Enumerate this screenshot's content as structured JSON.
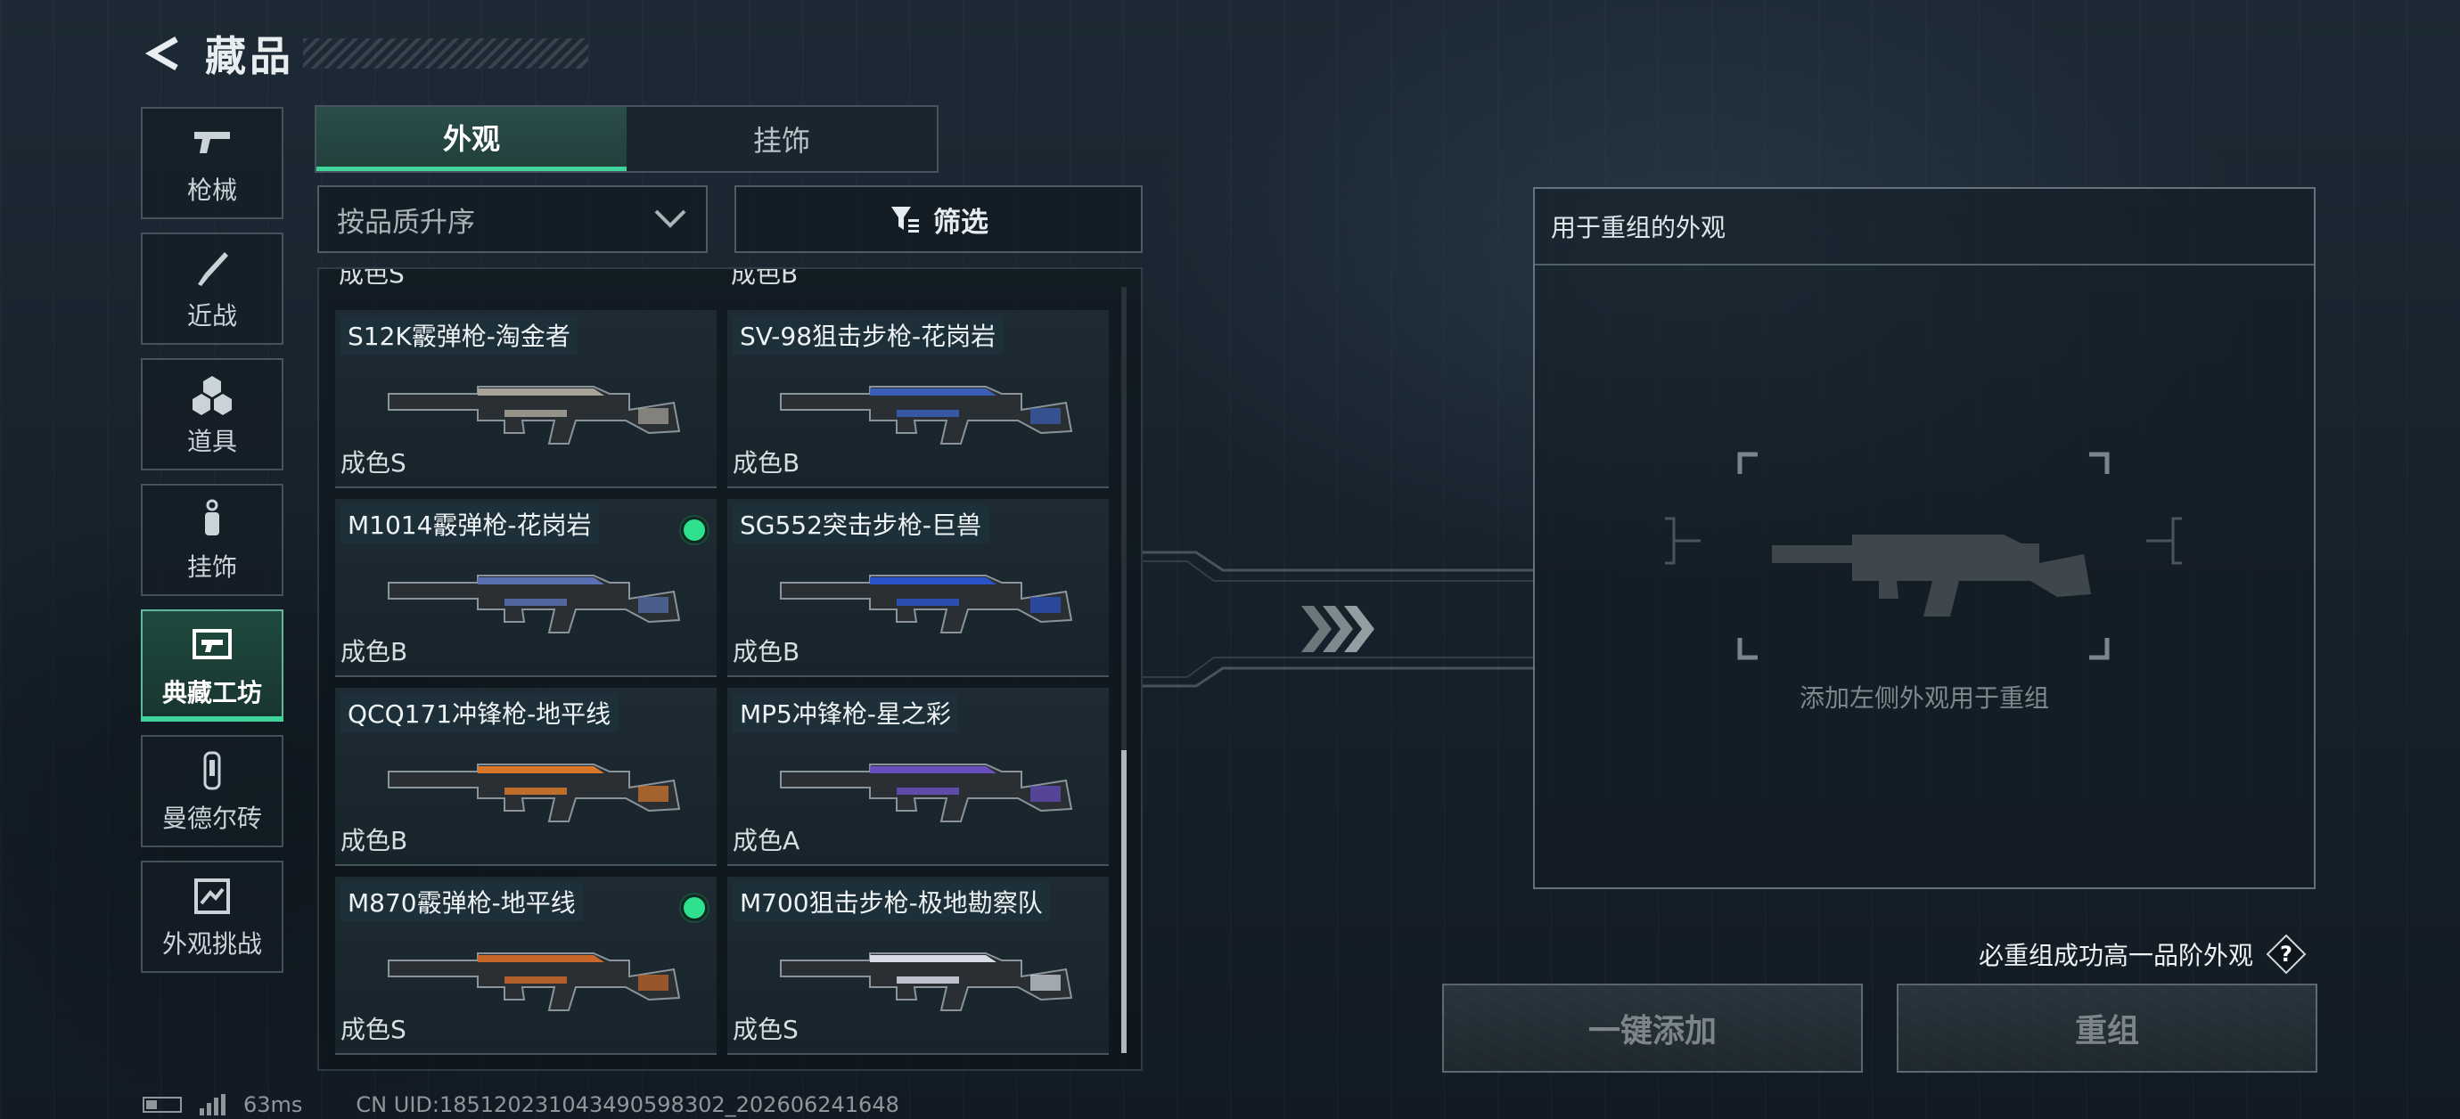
{
  "header": {
    "title": "藏品"
  },
  "sidenav": [
    {
      "label": "枪械",
      "icon": "pistol-icon",
      "active": false
    },
    {
      "label": "近战",
      "icon": "knife-icon",
      "active": false
    },
    {
      "label": "道具",
      "icon": "grenade-icon",
      "active": false
    },
    {
      "label": "挂饰",
      "icon": "charm-icon",
      "active": false
    },
    {
      "label": "典藏工坊",
      "icon": "workshop-icon",
      "active": true
    },
    {
      "label": "曼德尔砖",
      "icon": "brick-icon",
      "active": false
    },
    {
      "label": "外观挑战",
      "icon": "challenge-icon",
      "active": false
    }
  ],
  "tabs": {
    "appearance": "外观",
    "charms": "挂饰"
  },
  "sort": {
    "label": "按品质升序"
  },
  "filter": {
    "label": "筛选"
  },
  "grid": {
    "clipped_top": [
      "成色S",
      "成色B"
    ],
    "items": [
      {
        "name": "S12K霰弹枪-淘金者",
        "grade": "成色S",
        "selected": false,
        "accent": "#a8a49a"
      },
      {
        "name": "SV-98狙击步枪-花岗岩",
        "grade": "成色B",
        "selected": false,
        "accent": "#3b5fb8"
      },
      {
        "name": "M1014霰弹枪-花岗岩",
        "grade": "成色B",
        "selected": true,
        "accent": "#5a70b0"
      },
      {
        "name": "SG552突击步枪-巨兽",
        "grade": "成色B",
        "selected": false,
        "accent": "#2b54c8"
      },
      {
        "name": "QCQ171冲锋枪-地平线",
        "grade": "成色B",
        "selected": false,
        "accent": "#d9782a"
      },
      {
        "name": "MP5冲锋枪-星之彩",
        "grade": "成色A",
        "selected": false,
        "accent": "#6a4fc0"
      },
      {
        "name": "M870霰弹枪-地平线",
        "grade": "成色S",
        "selected": true,
        "accent": "#c9672a"
      },
      {
        "name": "M700狙击步枪-极地勘察队",
        "grade": "成色S",
        "selected": false,
        "accent": "#d6dbe6"
      }
    ]
  },
  "reforge": {
    "header": "用于重组的外观",
    "empty_hint": "添加左侧外观用于重组"
  },
  "guarantee": {
    "text": "必重组成功高一品阶外观",
    "help": "?"
  },
  "buttons": {
    "add_all": "一键添加",
    "reforge": "重组"
  },
  "footer": {
    "ping": "63ms",
    "uid": "CN UID:18512023104349059830​2_202606241648"
  },
  "colors": {
    "accent": "#3fd59b",
    "selected_dot": "#2fe08f"
  }
}
